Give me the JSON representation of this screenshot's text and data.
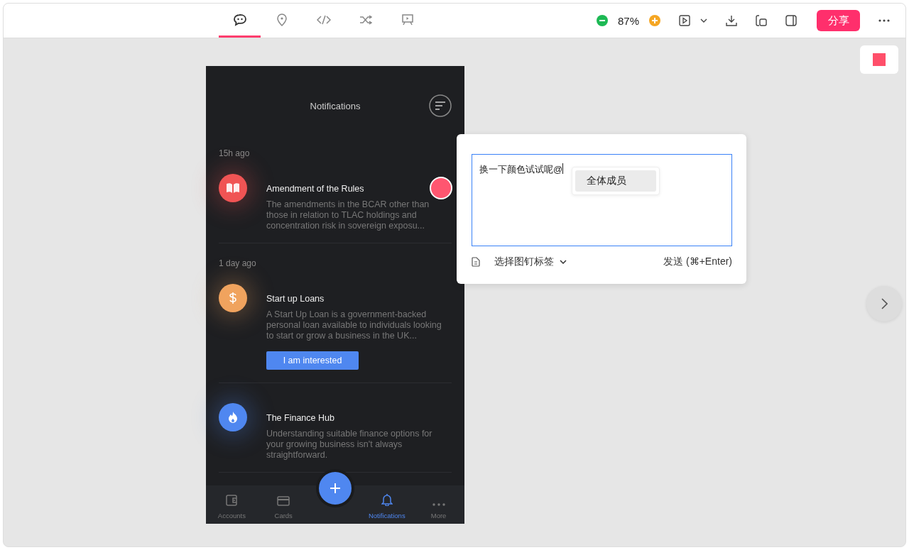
{
  "toolbar": {
    "tabs": [
      {
        "kind": "chat",
        "selected": true
      },
      {
        "kind": "pin",
        "selected": false
      },
      {
        "kind": "code",
        "selected": false
      },
      {
        "kind": "shuffle",
        "selected": false
      },
      {
        "kind": "presentation",
        "selected": false
      }
    ],
    "zoom": "87%",
    "share_button": "分享"
  },
  "phone": {
    "title": "Notifications",
    "groups": [
      {
        "time": "15h ago",
        "items": [
          {
            "kind": "book",
            "color": "#f05454",
            "title": "Amendment of the Rules",
            "body": "The amendments in the BCAR other than those in relation to TLAC holdings and concentration risk in sovereign exposu..."
          }
        ]
      },
      {
        "time": "1 day ago",
        "items": [
          {
            "kind": "dollar",
            "color": "#f0a35e",
            "title": "Start up Loans",
            "body": "A Start Up Loan is a government-backed personal loan available to individuals looking to start or grow a business in the UK...",
            "action": "I am interested"
          },
          {
            "kind": "flame",
            "color": "#4f87f0",
            "title": "The Finance Hub",
            "body": "Understanding suitable finance options for your growing business isn't always straightforward."
          }
        ]
      }
    ],
    "tab_bar": [
      {
        "kind": "wallet",
        "label": "Accounts",
        "selected": false
      },
      {
        "kind": "card",
        "label": "Cards",
        "selected": false
      },
      {
        "kind": "add"
      },
      {
        "kind": "bell",
        "label": "Notifications",
        "selected": true
      },
      {
        "kind": "more",
        "label": "More",
        "selected": false
      }
    ]
  },
  "comment": {
    "text": "换一下颜色试试呢@",
    "mentions": [
      {
        "label": "全体成员",
        "selected": true
      }
    ],
    "tag_select": "选择图钉标签",
    "send_button": "发送 (⌘+Enter)"
  }
}
